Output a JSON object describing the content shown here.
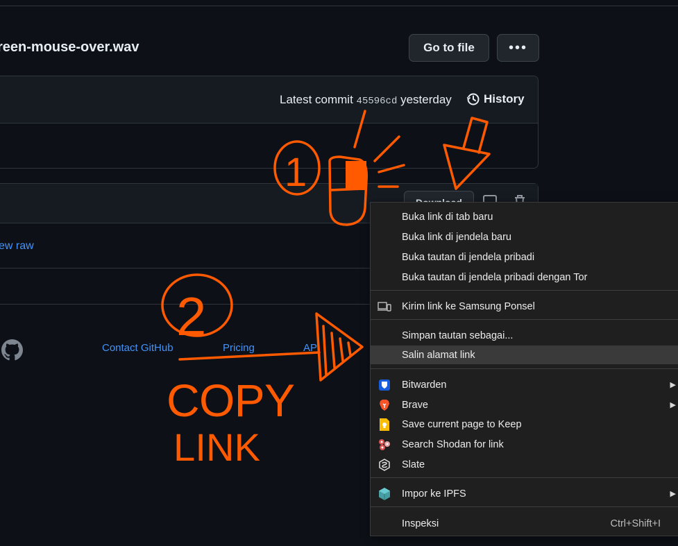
{
  "file": {
    "name": "reen-mouse-over.wav",
    "goto_label": "Go to file",
    "more_label": "•••"
  },
  "commit": {
    "latest_label": "Latest commit",
    "sha": "45596cd",
    "when": "yesterday",
    "history_label": "History"
  },
  "file_view": {
    "download_label": "Download",
    "view_raw_label": "ew raw"
  },
  "footer": {
    "links": [
      "Contact GitHub",
      "Pricing",
      "AP"
    ]
  },
  "context_menu": {
    "items": [
      {
        "label": "Buka link di tab baru"
      },
      {
        "label": "Buka link di jendela baru"
      },
      {
        "label": "Buka tautan di jendela pribadi"
      },
      {
        "label": "Buka tautan di jendela pribadi dengan Tor"
      },
      {
        "label": "Kirim link ke Samsung Ponsel",
        "icon": "devices-icon"
      },
      {
        "label": "Simpan tautan sebagai..."
      },
      {
        "label": "Salin alamat link",
        "highlighted": true
      },
      {
        "label": "Bitwarden",
        "icon": "bitwarden-icon",
        "submenu": true
      },
      {
        "label": "Brave",
        "icon": "brave-icon",
        "submenu": true
      },
      {
        "label": "Save current page to Keep",
        "icon": "keep-icon"
      },
      {
        "label": "Search Shodan for link",
        "icon": "shodan-icon"
      },
      {
        "label": "Slate",
        "icon": "slate-icon"
      },
      {
        "label": "Impor ke IPFS",
        "icon": "ipfs-icon",
        "submenu": true
      },
      {
        "label": "Inspeksi",
        "shortcut": "Ctrl+Shift+I"
      }
    ]
  },
  "annotations": {
    "step1": "1",
    "step2": "2",
    "copy": "COPY",
    "link": "LINK",
    "color": "#ff5a00"
  }
}
